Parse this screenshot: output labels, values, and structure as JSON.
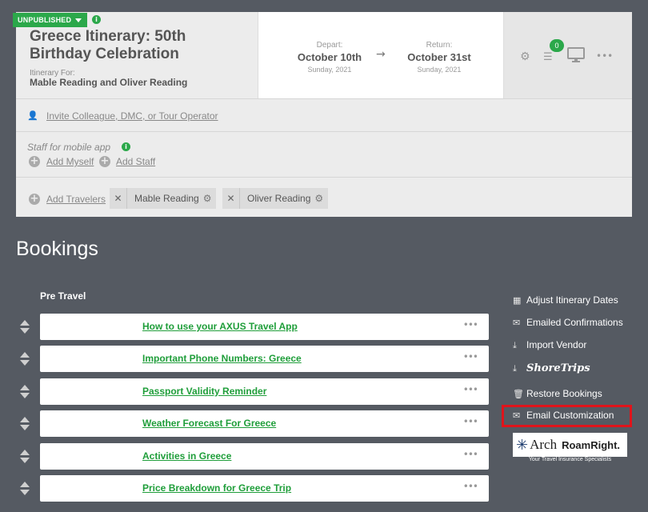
{
  "itinerary": {
    "status": "UNPUBLISHED",
    "title_line1": "Greece Itinerary: 50th",
    "title_line2": "Birthday Celebration",
    "for_label": "Itinerary For:",
    "for_names": "Mable Reading and Oliver Reading",
    "depart_label": "Depart:",
    "depart_date": "October 10th",
    "depart_day": "Sunday, 2021",
    "return_label": "Return:",
    "return_date": "October 31st",
    "return_day": "Sunday, 2021",
    "task_count": "0"
  },
  "collab": {
    "invite_link": "Invite Colleague, DMC, or Tour Operator",
    "staff_label": "Staff for mobile app",
    "add_myself": "Add Myself",
    "add_staff": "Add Staff",
    "add_travelers": "Add Travelers",
    "travelers": [
      "Mable Reading",
      "Oliver Reading"
    ]
  },
  "bookings": {
    "heading": "Bookings",
    "section": "Pre Travel",
    "items": [
      "How to use your AXUS Travel App",
      "Important Phone Numbers: Greece",
      "Passport Validity Reminder",
      "Weather Forecast For Greece",
      "Activities in Greece",
      "Price Breakdown for Greece Trip"
    ]
  },
  "sidebar": {
    "adjust_dates": "Adjust Itinerary Dates",
    "emailed_confirmations": "Emailed Confirmations",
    "import_vendor": "Import Vendor",
    "shoretrips": "ShoreTrips",
    "restore_bookings": "Restore Bookings",
    "email_customization": "Email Customization",
    "arch_brand": "Arch",
    "roamright_brand": "RoamRight.",
    "tagline": "Your Travel Insurance Specialists"
  },
  "colors": {
    "accent": "#2ba84a",
    "background": "#555a62",
    "highlight": "#e0141b"
  }
}
